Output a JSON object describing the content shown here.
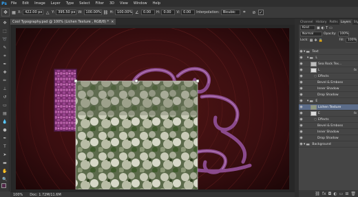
{
  "app": {
    "logo": "Ps"
  },
  "menu": [
    "File",
    "Edit",
    "Image",
    "Layer",
    "Type",
    "Select",
    "Filter",
    "3D",
    "View",
    "Window",
    "Help"
  ],
  "options": {
    "x_label": "X:",
    "x_value": "422.00 px",
    "y_label": "Y:",
    "y_value": "395.50 px",
    "w_label": "W:",
    "w_value": "100.00%",
    "h_label": "H:",
    "h_value": "100.00%",
    "angle_value": "0.00",
    "hskew_label": "H:",
    "hskew_value": "0.00",
    "vskew_label": "V:",
    "vskew_value": "0.00",
    "interpolation_label": "Interpolation:",
    "interpolation_value": "Bicubic",
    "cancel_icon": "cancel-icon",
    "commit_icon": "commit-check-icon"
  },
  "document": {
    "tab_title": "Cool Typography.psd @ 100% (Lichen Texture , RGB/8) *",
    "close_glyph": "×"
  },
  "status": {
    "zoom": "100%",
    "doc_info": "Doc: 1.72M/11.6M"
  },
  "panel": {
    "tabs": [
      "Channel",
      "History",
      "Paths",
      "Layers",
      "Styles"
    ],
    "active_tab": "Layers",
    "kind_filter": "Kind",
    "blend_mode": "Normal",
    "opacity_label": "Opacity:",
    "opacity_value": "100%",
    "lock_label": "Lock:",
    "fill_label": "Fill:",
    "fill_value": "100%",
    "layers": [
      {
        "name": "Text",
        "type": "group",
        "indent": 0,
        "selected": false
      },
      {
        "name": "L",
        "type": "group",
        "indent": 1,
        "selected": false
      },
      {
        "name": "Sea Rock Tex...",
        "type": "layer",
        "indent": 2,
        "selected": false,
        "fx": false
      },
      {
        "name": "L",
        "type": "layer",
        "indent": 2,
        "selected": false,
        "fx": true
      },
      {
        "name": "Effects",
        "type": "effects",
        "indent": 3,
        "selected": false
      },
      {
        "name": "Bevel & Emboss",
        "type": "effect",
        "indent": 4,
        "selected": false
      },
      {
        "name": "Inner Shadow",
        "type": "effect",
        "indent": 4,
        "selected": false
      },
      {
        "name": "Drop Shadow",
        "type": "effect",
        "indent": 4,
        "selected": false
      },
      {
        "name": "E",
        "type": "group",
        "indent": 1,
        "selected": false
      },
      {
        "name": "Lichen Texture",
        "type": "layer",
        "indent": 2,
        "selected": true,
        "fx": false
      },
      {
        "name": "E",
        "type": "layer",
        "indent": 2,
        "selected": false,
        "fx": true
      },
      {
        "name": "Effects",
        "type": "effects",
        "indent": 3,
        "selected": false
      },
      {
        "name": "Bevel & Emboss",
        "type": "effect",
        "indent": 4,
        "selected": false
      },
      {
        "name": "Inner Shadow",
        "type": "effect",
        "indent": 4,
        "selected": false
      },
      {
        "name": "Drop Shadow",
        "type": "effect",
        "indent": 4,
        "selected": false
      },
      {
        "name": "Background",
        "type": "group",
        "indent": 0,
        "selected": false
      }
    ],
    "footer_icons": [
      "link-icon",
      "fx-icon",
      "mask-icon",
      "adjustment-icon",
      "folder-icon",
      "new-layer-icon",
      "trash-icon"
    ]
  },
  "colors": {
    "foreground": "#53284a",
    "background": "#ffffff",
    "accent": "#31a8ff"
  }
}
